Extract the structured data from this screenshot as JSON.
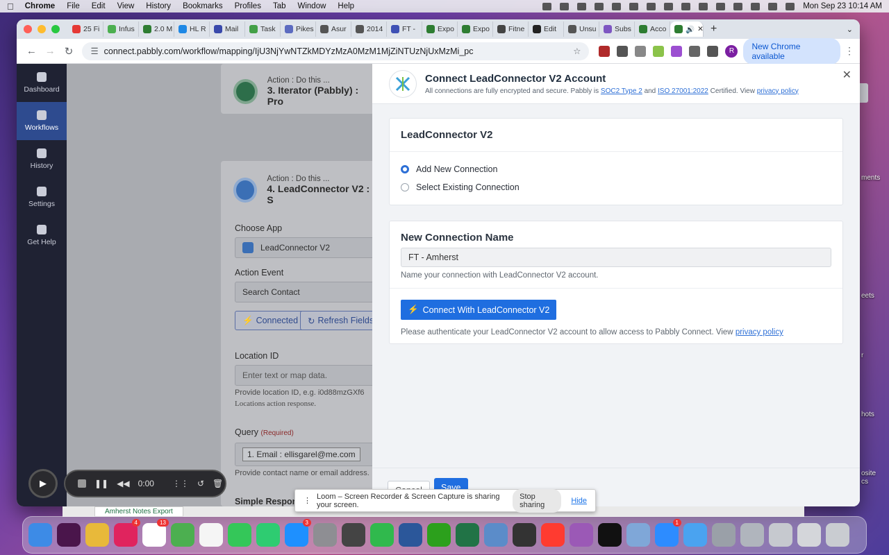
{
  "menubar": {
    "app_name": "Chrome",
    "items": [
      "File",
      "Edit",
      "View",
      "History",
      "Bookmarks",
      "Profiles",
      "Tab",
      "Window",
      "Help"
    ],
    "clock": "Mon Sep 23  10:14 AM"
  },
  "desktop_labels": [
    "ments",
    "eets",
    "r",
    "hots",
    "osite",
    "cs"
  ],
  "browser": {
    "tabs": [
      {
        "label": "25 Fi",
        "color": "#e53935"
      },
      {
        "label": "Infus",
        "color": "#4caf50"
      },
      {
        "label": "2.0 M",
        "color": "#2e7d32"
      },
      {
        "label": "HL R",
        "color": "#1e88e5"
      },
      {
        "label": "Mail",
        "color": "#3949ab"
      },
      {
        "label": "Task",
        "color": "#43a047"
      },
      {
        "label": "Pikes",
        "color": "#5c6bc0"
      },
      {
        "label": "Asur",
        "color": "#555555"
      },
      {
        "label": "2014",
        "color": "#555555"
      },
      {
        "label": "FT -",
        "color": "#3f51b5"
      },
      {
        "label": "Expo",
        "color": "#2e7d32"
      },
      {
        "label": "Expo",
        "color": "#2e7d32"
      },
      {
        "label": "Fitne",
        "color": "#444444"
      },
      {
        "label": "Edit",
        "color": "#222222"
      },
      {
        "label": "Unsu",
        "color": "#555555"
      },
      {
        "label": "Subs",
        "color": "#7e57c2"
      },
      {
        "label": "Acco",
        "color": "#2e7d32"
      }
    ],
    "url": "connect.pabbly.com/workflow/mapping/IjU3NjYwNTZkMDYzMzA0MzM1MjZiNTUzNjUxMzMi_pc",
    "new_chrome_label": "New Chrome available",
    "profile_initial": "R"
  },
  "sidebar": {
    "items": [
      {
        "label": "Dashboard",
        "active": false
      },
      {
        "label": "Workflows",
        "active": true
      },
      {
        "label": "History",
        "active": false
      },
      {
        "label": "Settings",
        "active": false
      },
      {
        "label": "Get Help",
        "active": false
      }
    ]
  },
  "workflow": {
    "step3": {
      "sub": "Action : Do this ...",
      "title": "3. Iterator (Pabbly) : Pro"
    },
    "step4": {
      "sub": "Action : Do this ...",
      "title": "4. LeadConnector V2 : S"
    },
    "choose_app_label": "Choose App",
    "choose_app_value": "LeadConnector V2",
    "action_event_label": "Action Event",
    "action_event_value": "Search Contact",
    "connected_label": "Connected",
    "refresh_label": "Refresh Fields",
    "location_label": "Location ID",
    "location_placeholder": "Enter text or map data.",
    "location_hint_1": "Provide location ID, e.g. i0d88mzGXf6",
    "location_hint_2": "Locations action response.",
    "query_label": "Query",
    "query_required": "(Required)",
    "query_value": "1. Email : ellisgarel@me.com",
    "query_hint": "Provide contact name or email address.",
    "simple_response_label": "Simple Respons"
  },
  "modal": {
    "title": "Connect LeadConnector V2 Account",
    "subtitle_pre": "All connections are fully encrypted and secure. Pabbly is",
    "soc_link": "SOC2 Type 2",
    "and_text": "and",
    "iso_link": "ISO 27001:2022",
    "subtitle_post": "Certified. View",
    "privacy_link": "privacy policy",
    "app_section_title": "LeadConnector V2",
    "radio_add": "Add New Connection",
    "radio_existing": "Select Existing Connection",
    "name_section_title": "New Connection Name",
    "name_value": "FT - Amherst",
    "name_help": "Name your connection with LeadConnector V2 account.",
    "connect_button": "Connect With LeadConnector V2",
    "auth_help": "Please authenticate your LeadConnector V2 account to allow access to Pabbly Connect. View",
    "auth_privacy_link": "privacy policy",
    "cancel_label": "Cancel",
    "save_label": "Save"
  },
  "loom": {
    "timer": "0:00",
    "share_text": "Loom – Screen Recorder & Screen Capture is sharing your screen.",
    "stop_label": "Stop sharing",
    "hide_label": "Hide"
  },
  "spreadsheet": {
    "sheet_tab": "Amherst Notes Export"
  },
  "dock": {
    "apps": [
      {
        "name": "finder",
        "color": "#3d8be6"
      },
      {
        "name": "slack",
        "color": "#4a154b"
      },
      {
        "name": "chrome",
        "color": "#e8b93a"
      },
      {
        "name": "pocketcasts",
        "color": "#e0245e",
        "badge": "4"
      },
      {
        "name": "calendar",
        "color": "#ffffff",
        "badge": "13"
      },
      {
        "name": "maps",
        "color": "#4caf50"
      },
      {
        "name": "notes",
        "color": "#f5f5f5"
      },
      {
        "name": "messages",
        "color": "#34c759"
      },
      {
        "name": "facetime",
        "color": "#2ecc71"
      },
      {
        "name": "app-store",
        "color": "#1e90ff",
        "badge": "3"
      },
      {
        "name": "settings",
        "color": "#8e8e93"
      },
      {
        "name": "script-editor",
        "color": "#444444"
      },
      {
        "name": "numbers",
        "color": "#30b94d"
      },
      {
        "name": "word",
        "color": "#2b579a"
      },
      {
        "name": "quickbooks",
        "color": "#2ca01c"
      },
      {
        "name": "excel",
        "color": "#217346"
      },
      {
        "name": "network",
        "color": "#5b8cc9"
      },
      {
        "name": "calculator",
        "color": "#333333"
      },
      {
        "name": "news",
        "color": "#ff3b30"
      },
      {
        "name": "podcasts",
        "color": "#9b59b6"
      },
      {
        "name": "tv",
        "color": "#111111"
      },
      {
        "name": "preview",
        "color": "#7fa7d8"
      },
      {
        "name": "zoom",
        "color": "#2d8cff",
        "badge": "1"
      },
      {
        "name": "mail",
        "color": "#4aa3f0"
      },
      {
        "name": "folder-1",
        "color": "#9aa0a8"
      },
      {
        "name": "folder-2",
        "color": "#b0b5bd"
      },
      {
        "name": "folder-3",
        "color": "#c6c9cf"
      },
      {
        "name": "folder-4",
        "color": "#d4d6da"
      },
      {
        "name": "trash",
        "color": "#c9ccd1"
      }
    ]
  }
}
